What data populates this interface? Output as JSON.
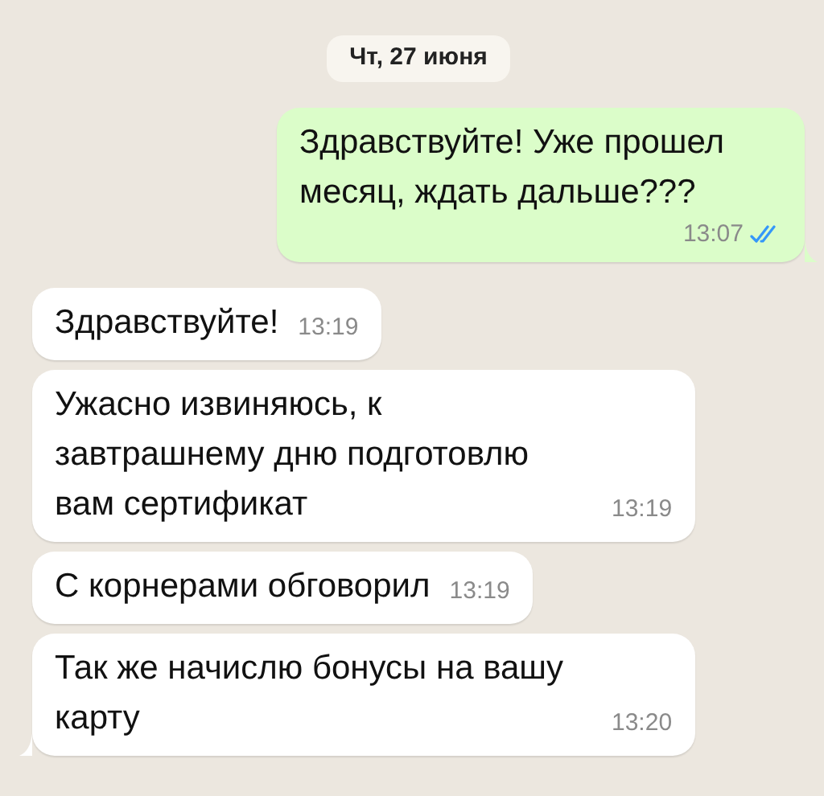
{
  "date_label": "Чт, 27 июня",
  "messages": [
    {
      "kind": "outgoing",
      "text": "Здравствуйте! Уже прошел месяц, ждать дальше???",
      "time": "13:07",
      "read": true,
      "tail": true
    },
    {
      "kind": "incoming",
      "text": "Здравствуйте!",
      "time": "13:19",
      "tail": false
    },
    {
      "kind": "incoming",
      "text": "Ужасно извиняюсь, к завтрашнему дню подготовлю вам сертификат",
      "time": "13:19",
      "tail": false
    },
    {
      "kind": "incoming",
      "text": "С корнерами обговорил",
      "time": "13:19",
      "tail": false
    },
    {
      "kind": "incoming",
      "text": "Так же начислю бонусы на вашу карту",
      "time": "13:20",
      "tail": true
    }
  ]
}
